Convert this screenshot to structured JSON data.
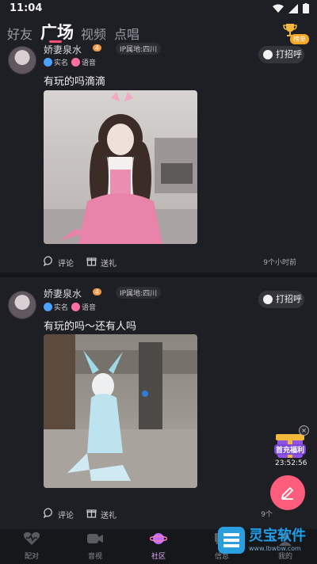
{
  "status_bar": {
    "time": "11:04"
  },
  "top_nav": {
    "tabs": [
      {
        "label": "好友",
        "active": false
      },
      {
        "label": "广场",
        "active": true
      },
      {
        "label": "视频",
        "active": false
      },
      {
        "label": "点唱",
        "active": false
      }
    ],
    "rank_badge": "榜单"
  },
  "posts": [
    {
      "username": "娇妻泉水",
      "level": "4",
      "location": "IP属地:四川",
      "badges": [
        {
          "label": "实名",
          "icon": "verified-icon"
        },
        {
          "label": "语音",
          "icon": "voice-icon"
        }
      ],
      "greet_label": "打招呼",
      "text": "有玩的吗滴滴",
      "comment_label": "评论",
      "gift_label": "送礼",
      "time": "9个小时前"
    },
    {
      "username": "娇妻泉水",
      "level": "4",
      "location": "IP属地:四川",
      "badges": [
        {
          "label": "实名",
          "icon": "verified-icon"
        },
        {
          "label": "语音",
          "icon": "voice-icon"
        }
      ],
      "greet_label": "打招呼",
      "text": "有玩的吗～还有人吗",
      "comment_label": "评论",
      "gift_label": "送礼",
      "time": "9个"
    }
  ],
  "promo": {
    "label": "首充福利",
    "countdown": "23:52:56"
  },
  "bottom_nav": [
    {
      "label": "配对",
      "icon": "heartbeat-icon",
      "active": false
    },
    {
      "label": "音视",
      "icon": "video-icon",
      "active": false
    },
    {
      "label": "社区",
      "icon": "planet-icon",
      "active": true
    },
    {
      "label": "信息",
      "icon": "message-icon",
      "active": false
    },
    {
      "label": "我的",
      "icon": "profile-icon",
      "active": false
    }
  ],
  "watermark": {
    "title": "灵宝软件",
    "url": "www.lbwbw.com"
  },
  "colors": {
    "background": "#1e1f24",
    "accent": "#ff4d73",
    "fab": "#ff5d7b",
    "active_nav": "#e9b2ff"
  }
}
